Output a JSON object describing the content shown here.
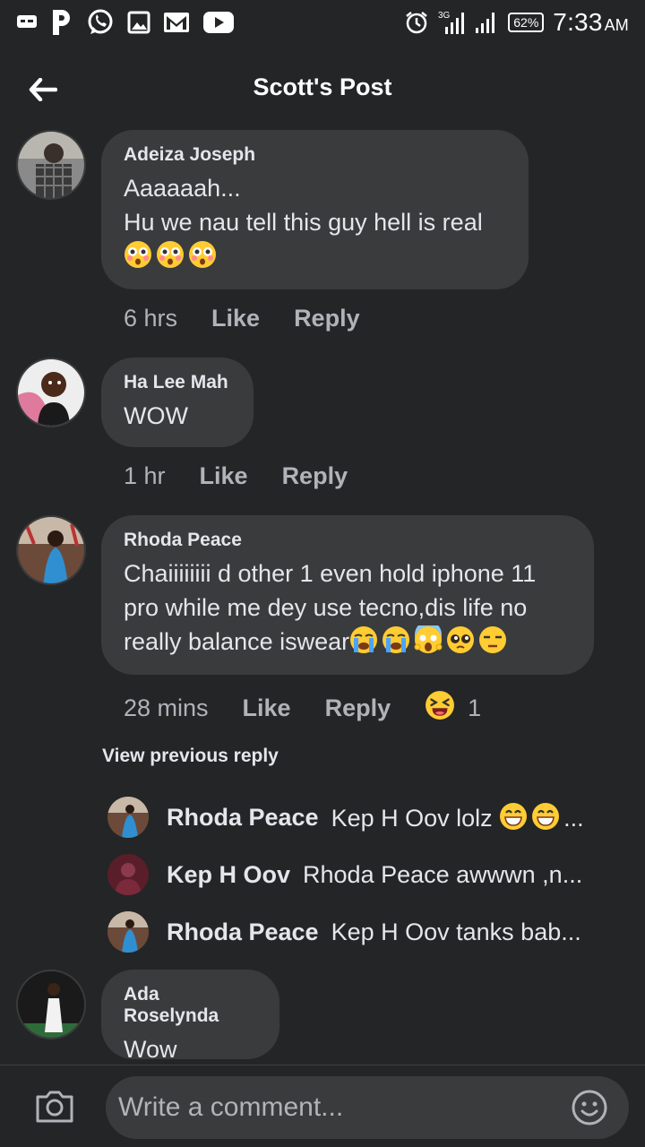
{
  "status_bar": {
    "network": "3G",
    "battery": "62%",
    "time": "7:33",
    "ampm": "AM",
    "icons": [
      "message-icon",
      "p-app-icon",
      "whatsapp-icon",
      "gallery-icon",
      "gmail-icon",
      "youtube-icon",
      "alarm-icon",
      "signal-icon",
      "signal-icon-2",
      "battery-icon"
    ]
  },
  "header": {
    "title": "Scott's Post",
    "back_icon": "back-arrow-icon"
  },
  "comments": [
    {
      "author": "Adeiza Joseph",
      "text": "Aaaaaah...\nHu we nau tell this guy hell is real",
      "emojis": [
        "flushed-face",
        "flushed-face",
        "flushed-face"
      ],
      "time": "6 hrs",
      "like": "Like",
      "reply": "Reply"
    },
    {
      "author": "Ha Lee Mah",
      "text": "WOW",
      "time": "1 hr",
      "like": "Like",
      "reply": "Reply"
    },
    {
      "author": "Rhoda Peace",
      "text_line1": "Chaiiiiiiii d other  1 even hold iphone 11",
      "text_line2": "pro while me dey use tecno,dis life no",
      "text_line3": "really balance iswear",
      "emojis": [
        "loudly-crying-face",
        "loudly-crying-face",
        "screaming-face",
        "pleading-face",
        "unamused-face"
      ],
      "time": "28 mins",
      "like": "Like",
      "reply": "Reply",
      "reaction": "laughing-face",
      "reaction_count": "1"
    },
    {
      "author": "Ada Roselynda",
      "text": "Wow"
    }
  ],
  "view_previous": "View previous reply",
  "replies": [
    {
      "name": "Rhoda Peace",
      "text": "Kep H Oov lolz",
      "emojis": [
        "grinning-face",
        "grinning-face"
      ],
      "suffix": "..."
    },
    {
      "name": "Kep H Oov",
      "text": "Rhoda Peace awwwn ,n..."
    },
    {
      "name": "Rhoda Peace",
      "text": "Kep H Oov tanks bab..."
    }
  ],
  "composer": {
    "placeholder": "Write a comment...",
    "camera_icon": "camera-icon",
    "emoji_icon": "smiley-icon"
  }
}
